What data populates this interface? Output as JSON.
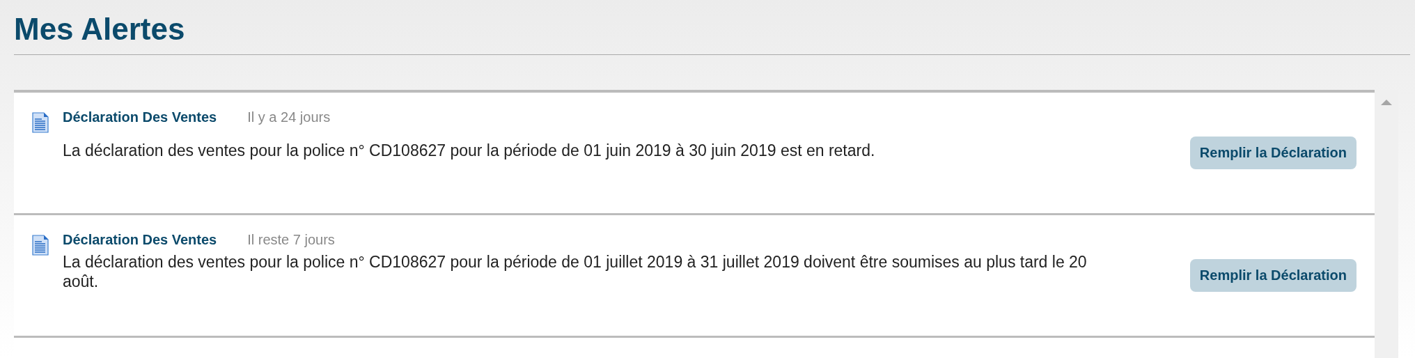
{
  "title": "Mes Alertes",
  "alerts": [
    {
      "heading": "Déclaration Des Ventes",
      "time": "Il y a 24 jours",
      "message": "La déclaration des ventes pour la police n° CD108627 pour la période de 01 juin 2019 à 30 juin 2019 est en retard.",
      "action": "Remplir la Déclaration"
    },
    {
      "heading": "Déclaration Des Ventes",
      "time": "Il reste 7 jours",
      "message": "La déclaration des ventes pour la police n° CD108627 pour la période de 01 juillet 2019 à 31 juillet 2019 doivent être soumises au plus tard le 20 août.",
      "action": "Remplir la Déclaration"
    }
  ]
}
